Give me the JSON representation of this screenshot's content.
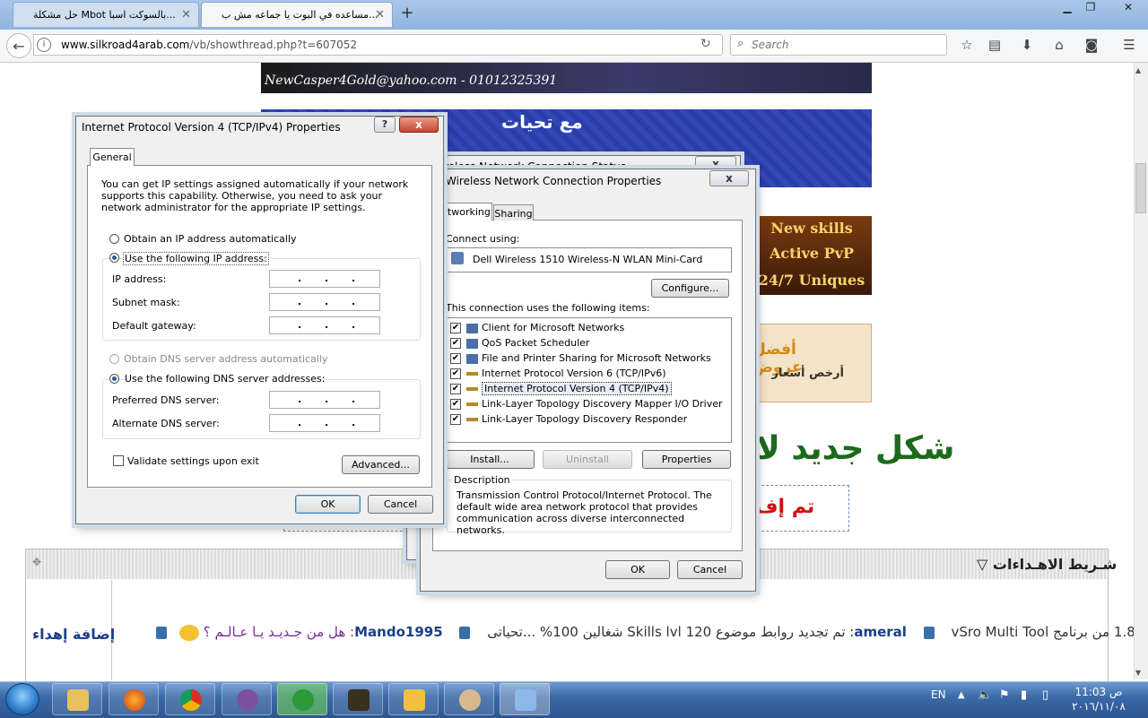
{
  "browser": {
    "tabs": [
      {
        "label": "حل مشكلة Mbot بالسوكت اسبا..."
      },
      {
        "label": "مساعده في البوت يا جماعه مش ب..."
      }
    ],
    "new_tab": "+",
    "url_host": "www.silkroad4arab.com",
    "url_path": "/vb/showthread.php?t=607052",
    "search_placeholder": "Search"
  },
  "page": {
    "banner1_text": "NewCasper4Gold@yahoo.com - 01012325391",
    "banner2_text": "مع تحيات",
    "banner3_lines": [
      "New skills",
      "Active PvP",
      "24/7 Uniques"
    ],
    "banner4_line1": "أفضل عروض",
    "banner4_line2": "أرخص أسعار",
    "big_title": "شكل جديد لا",
    "red_text": "تم إف",
    "gifts_title": "شـريط الاهـداءات",
    "add_gift": "إضافة إهداء",
    "ticker": {
      "i1": "1.8 من برنامج vSro Multi Tool",
      "u2": "ameral",
      "i2": ": تم تجديد روابط موضوع 120 Skills lvl شغالين 100% ...تحياتى",
      "u3": "Mando1995",
      "i3": ": هل من جـديـد يـا عـالـم ؟"
    }
  },
  "ipv4_dialog": {
    "title": "Internet Protocol Version 4 (TCP/IPv4) Properties",
    "help": "?",
    "close": "x",
    "tab_general": "General",
    "intro": "You can get IP settings assigned automatically if your network supports this capability. Otherwise, you need to ask your network administrator for the appropriate IP settings.",
    "obtain_ip_auto": "Obtain an IP address automatically",
    "use_following_ip": "Use the following IP address:",
    "ip_address": "IP address:",
    "subnet_mask": "Subnet mask:",
    "default_gateway": "Default gateway:",
    "obtain_dns_auto": "Obtain DNS server address automatically",
    "use_following_dns": "Use the following DNS server addresses:",
    "preferred_dns": "Preferred DNS server:",
    "alternate_dns": "Alternate DNS server:",
    "validate": "Validate settings upon exit",
    "advanced": "Advanced...",
    "ok": "OK",
    "cancel": "Cancel",
    "ip_dots": "."
  },
  "status_dialog": {
    "title": "reless Network Connection Status",
    "close": "x"
  },
  "props_dialog": {
    "title": "Wireless Network Connection Properties",
    "close": "x",
    "tab_networking": "etworking",
    "tab_sharing": "Sharing",
    "connect_using": "Connect using:",
    "adapter": "Dell Wireless 1510 Wireless-N WLAN Mini-Card",
    "configure": "Configure...",
    "items_label": "This connection uses the following items:",
    "items": [
      {
        "label": "Client for Microsoft Networks",
        "checked": true
      },
      {
        "label": "QoS Packet Scheduler",
        "checked": true
      },
      {
        "label": "File and Printer Sharing for Microsoft Networks",
        "checked": true
      },
      {
        "label": "Internet Protocol Version 6 (TCP/IPv6)",
        "checked": true
      },
      {
        "label": "Internet Protocol Version 4 (TCP/IPv4)",
        "checked": true
      },
      {
        "label": "Link-Layer Topology Discovery Mapper I/O Driver",
        "checked": true
      },
      {
        "label": "Link-Layer Topology Discovery Responder",
        "checked": true
      }
    ],
    "install": "Install...",
    "uninstall": "Uninstall",
    "properties": "Properties",
    "description_label": "Description",
    "description": "Transmission Control Protocol/Internet Protocol. The default wide area network protocol that provides communication across diverse interconnected networks.",
    "ok": "OK",
    "cancel": "Cancel"
  },
  "taskbar": {
    "lang": "EN",
    "time": "11:03 ص",
    "date": "٢٠١٦/١١/٠٨"
  }
}
